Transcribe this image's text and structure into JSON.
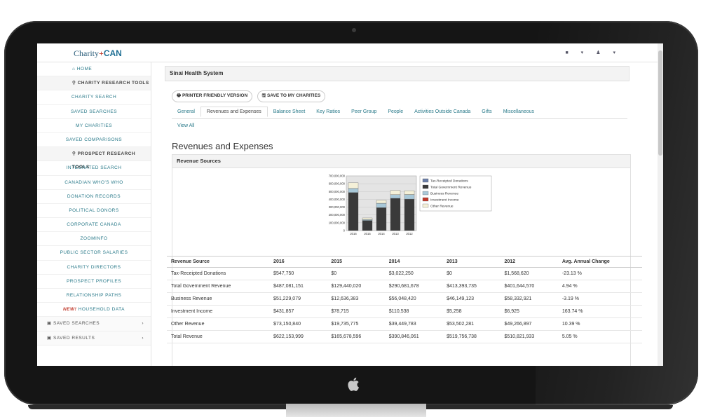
{
  "app": {
    "logo_part1": "Charity",
    "logo_plus": "+",
    "logo_part2": "CAN"
  },
  "sidebar": {
    "items": [
      {
        "label": "HOME",
        "type": "home",
        "icon": "home-icon"
      },
      {
        "label": "CHARITY RESEARCH TOOLS",
        "type": "header",
        "icon": "search-icon"
      },
      {
        "label": "CHARITY SEARCH",
        "type": "item"
      },
      {
        "label": "SAVED SEARCHES",
        "type": "item"
      },
      {
        "label": "MY CHARITIES",
        "type": "item"
      },
      {
        "label": "SAVED COMPARISONS",
        "type": "item"
      },
      {
        "label": "PROSPECT RESEARCH TOOLS",
        "type": "header",
        "icon": "search-icon"
      },
      {
        "label": "INTEGRATED SEARCH",
        "type": "item"
      },
      {
        "label": "CANADIAN WHO'S WHO",
        "type": "item"
      },
      {
        "label": "DONATION RECORDS",
        "type": "item"
      },
      {
        "label": "POLITICAL DONORS",
        "type": "item"
      },
      {
        "label": "CORPORATE CANADA",
        "type": "item"
      },
      {
        "label": "ZOOMINFO",
        "type": "item"
      },
      {
        "label": "PUBLIC SECTOR SALARIES",
        "type": "item"
      },
      {
        "label": "CHARITY DIRECTORS",
        "type": "item"
      },
      {
        "label": "PROSPECT PROFILES",
        "type": "item"
      },
      {
        "label": "RELATIONSHIP PATHS",
        "type": "item"
      }
    ],
    "new_badge": "NEW!",
    "household_label": "HOUSEHOLD DATA",
    "collapse_items": [
      {
        "label": "SAVED SEARCHES",
        "icon": "saved-icon"
      },
      {
        "label": "SAVED RESULTS",
        "icon": "saved-icon"
      }
    ]
  },
  "main": {
    "org_name": "Sinai Health System",
    "printer_button": "PRINTER FRIENDLY VERSION",
    "save_button": "SAVE TO MY CHARITIES",
    "tabs": [
      "General",
      "Revenues and Expenses",
      "Balance Sheet",
      "Key Ratios",
      "Peer Group",
      "People",
      "Activities Outside Canada",
      "Gifts",
      "Miscellaneous"
    ],
    "active_tab": "Revenues and Expenses",
    "view_all": "View All",
    "section_title": "Revenues and Expenses",
    "panel_title": "Revenue Sources"
  },
  "chart_data": {
    "type": "bar",
    "stacked": true,
    "categories": [
      "2016",
      "2015",
      "2014",
      "2013",
      "2012"
    ],
    "yticks": [
      "700,000,000",
      "600,000,000",
      "500,000,000",
      "400,000,000",
      "300,000,000",
      "200,000,000",
      "100,000,000",
      "0"
    ],
    "ylim": [
      0,
      700000000
    ],
    "legend_position": "right",
    "series": [
      {
        "name": "Tax-Receipted Donations",
        "color": "#6b7fa8",
        "values": [
          547750,
          0,
          3022250,
          0,
          1568620
        ]
      },
      {
        "name": "Total Government Revenue",
        "color": "#3a3a3a",
        "values": [
          487081151,
          129440020,
          290681678,
          413393735,
          401644570
        ]
      },
      {
        "name": "Business Revenue",
        "color": "#a8c8d8",
        "values": [
          51229079,
          12636383,
          56048420,
          46149123,
          58332921
        ]
      },
      {
        "name": "Investment Income",
        "color": "#c0392b",
        "values": [
          431857,
          78715,
          110538,
          5258,
          6925
        ]
      },
      {
        "name": "Other Revenue",
        "color": "#f4f0d8",
        "values": [
          73150840,
          19735775,
          39449783,
          53502281,
          49266897
        ]
      }
    ]
  },
  "table": {
    "headers": [
      "Revenue Source",
      "2016",
      "2015",
      "2014",
      "2013",
      "2012",
      "Avg. Annual Change"
    ],
    "rows": [
      [
        "Tax-Receipted Donations",
        "$547,750",
        "$0",
        "$3,022,250",
        "$0",
        "$1,568,620",
        "-23.13 %"
      ],
      [
        "Total Government Revenue",
        "$487,081,151",
        "$129,440,020",
        "$290,681,678",
        "$413,393,735",
        "$401,644,570",
        "4.94 %"
      ],
      [
        "Business Revenue",
        "$51,229,079",
        "$12,636,383",
        "$56,048,420",
        "$46,149,123",
        "$58,332,921",
        "-3.19 %"
      ],
      [
        "Investment Income",
        "$431,857",
        "$78,715",
        "$110,538",
        "$5,258",
        "$6,925",
        "163.74 %"
      ],
      [
        "Other Revenue",
        "$73,150,840",
        "$19,735,775",
        "$39,449,783",
        "$53,502,281",
        "$49,266,897",
        "10.39 %"
      ],
      [
        "Total Revenue",
        "$622,153,999",
        "$165,678,596",
        "$390,846,061",
        "$519,756,738",
        "$510,821,933",
        "5.05 %"
      ]
    ]
  }
}
